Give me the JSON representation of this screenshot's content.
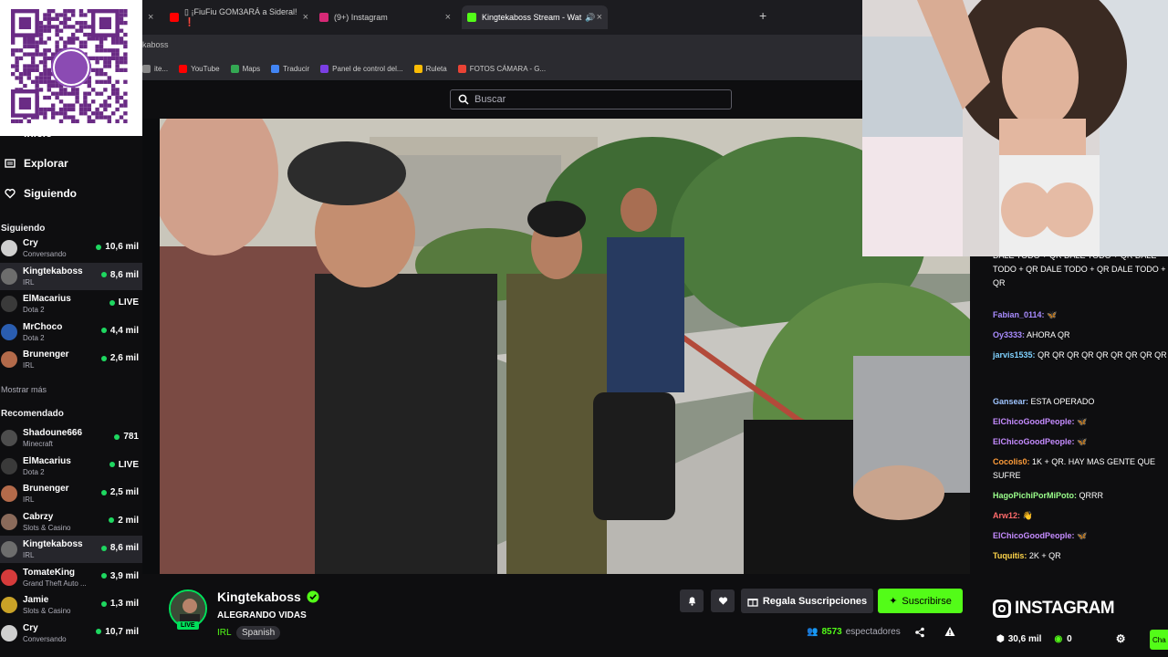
{
  "browser": {
    "tabs": [
      {
        "label": "",
        "has_close": true
      },
      {
        "label": "▯ ¡FiuFiu GOM3ARÁ a Sideral! ❗",
        "color": "#ff0000"
      },
      {
        "label": "(9+) Instagram",
        "color": "#d62976"
      },
      {
        "label": "Kingtekaboss Stream - Wat",
        "color": "#53fc18"
      }
    ],
    "new_tab": "+",
    "address": "kaboss",
    "bookmarks": [
      {
        "label": "ite...",
        "color": "#888888"
      },
      {
        "label": "YouTube",
        "color": "#ff0000"
      },
      {
        "label": "Maps",
        "color": "#34a853"
      },
      {
        "label": "Traducir",
        "color": "#4285f4"
      },
      {
        "label": "Panel de control del...",
        "color": "#7b3fe4"
      },
      {
        "label": "Ruleta",
        "color": "#fbbc05"
      },
      {
        "label": "FOTOS CÁMARA - G...",
        "color": "#ea4335"
      }
    ]
  },
  "search": {
    "placeholder": "Buscar"
  },
  "sidebar": {
    "nav": {
      "inicio": "Inicio",
      "explorar": "Explorar",
      "siguiendo": "Siguiendo"
    },
    "following_title": "Siguiendo",
    "following": [
      {
        "name": "Cry",
        "sub": "Conversando",
        "viewers": "10,6 mil",
        "color": "#cfcfcf"
      },
      {
        "name": "Kingtekaboss",
        "sub": "IRL",
        "viewers": "8,6 mil",
        "color": "#6d6d6d"
      },
      {
        "name": "ElMacarius",
        "sub": "Dota 2",
        "viewers": "LIVE",
        "color": "#3a3a3a"
      },
      {
        "name": "MrChoco",
        "sub": "Dota 2",
        "viewers": "4,4 mil",
        "color": "#2a5db0"
      },
      {
        "name": "Brunenger",
        "sub": "IRL",
        "viewers": "2,6 mil",
        "color": "#b36a4a"
      }
    ],
    "show_more": "Mostrar más",
    "recommended_title": "Recomendado",
    "recommended": [
      {
        "name": "Shadoune666",
        "sub": "Minecraft",
        "viewers": "781",
        "color": "#4d4d4d"
      },
      {
        "name": "ElMacarius",
        "sub": "Dota 2",
        "viewers": "LIVE",
        "color": "#3a3a3a"
      },
      {
        "name": "Brunenger",
        "sub": "IRL",
        "viewers": "2,5 mil",
        "color": "#b36a4a"
      },
      {
        "name": "Cabrzy",
        "sub": "Slots & Casino",
        "viewers": "2 mil",
        "color": "#8a6a5a"
      },
      {
        "name": "Kingtekaboss",
        "sub": "IRL",
        "viewers": "8,6 mil",
        "color": "#6d6d6d"
      },
      {
        "name": "TomateKing",
        "sub": "Grand Theft Auto ...",
        "viewers": "3,9 mil",
        "color": "#d63b3b"
      },
      {
        "name": "Jamie",
        "sub": "Slots & Casino",
        "viewers": "1,3 mil",
        "color": "#c9a227"
      },
      {
        "name": "Cry",
        "sub": "Conversando",
        "viewers": "10,7 mil",
        "color": "#cfcfcf"
      }
    ]
  },
  "stream": {
    "streamer": "Kingtekaboss",
    "live_tag": "LIVE",
    "title": "ALEGRANDO VIDAS",
    "category": "IRL",
    "language": "Spanish",
    "gift_label": "Regala Suscripciones",
    "subscribe_label": "Suscribirse",
    "viewers_count": "8573",
    "viewers_label": "espectadores",
    "accent": "#53fc18"
  },
  "chat": {
    "messages": [
      {
        "user": "",
        "text": "DALE TODO + QR  DALE TODO + QR  DALE TODO + QR  DALE TODO + QR  DALE TODO + QR",
        "color": "#ffffff"
      },
      {
        "user": "Fabian_0114:",
        "text": "🦋",
        "color": "#a98cff"
      },
      {
        "user": "Oy3333:",
        "text": "AHORA QR",
        "color": "#a98cff"
      },
      {
        "user": "jarvis1535:",
        "text": "QR  QR  QR  QR  QR  QR  QR  QR  QR",
        "color": "#7fd1ff"
      },
      {
        "user": "Gansear:",
        "text": "ESTA OPERADO",
        "color": "#9ec4ff"
      },
      {
        "user": "ElChicoGoodPeople:",
        "text": "🦋",
        "color": "#c58cff"
      },
      {
        "user": "ElChicoGoodPeople:",
        "text": "🦋",
        "color": "#c58cff"
      },
      {
        "user": "Cocolis0:",
        "text": "1K + QR. HAY MAS GENTE QUE SUFRE",
        "color": "#ff9d3a"
      },
      {
        "user": "HagoPichiPorMiPoto:",
        "text": "QRRR",
        "color": "#9bff8c"
      },
      {
        "user": "Arw12:",
        "text": "👋",
        "color": "#ff6b6b"
      },
      {
        "user": "ElChicoGoodPeople:",
        "text": "🦋",
        "color": "#c58cff"
      },
      {
        "user": "Tuquitis:",
        "text": "2K + QR",
        "color": "#ffd54a"
      }
    ],
    "instagram_label": "INSTAGRAM",
    "likes": "30,6 mil",
    "coins": "0",
    "chat_button": "Cha"
  }
}
